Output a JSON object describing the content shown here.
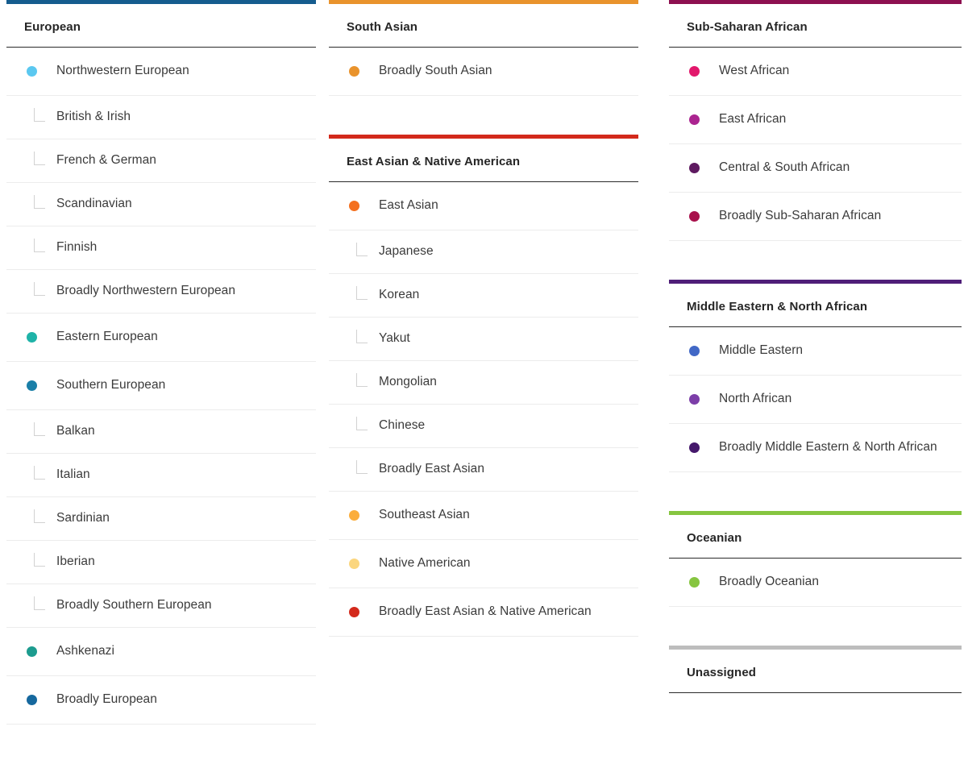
{
  "meta": {
    "title": "Ancestry Composition Legend",
    "columns": 3
  },
  "colors": {
    "european_bar": "#155C8E",
    "south_asian_bar": "#E9932C",
    "east_asian_bar": "#D3291B",
    "sub_saharan_bar": "#8D1050",
    "mena_bar": "#4F1E78",
    "oceanian_bar": "#86C540",
    "unassigned_bar": "#BDBDBD",
    "header_rule": "#2a2a2a",
    "row_divider": "#ececec",
    "elbow": "#d2d2d2",
    "title_text": "#262626",
    "label_text": "#3b3b3b"
  },
  "columns": [
    {
      "id": "column-1",
      "groups": [
        {
          "id": "group-european",
          "title": "European",
          "bar_color": "#155C8E",
          "rows": [
            {
              "label": "Northwestern European",
              "type": "dot",
              "color": "#5BC8F0"
            },
            {
              "label": "British & Irish",
              "type": "sub"
            },
            {
              "label": "French & German",
              "type": "sub"
            },
            {
              "label": "Scandinavian",
              "type": "sub"
            },
            {
              "label": "Finnish",
              "type": "sub"
            },
            {
              "label": "Broadly Northwestern European",
              "type": "sub"
            },
            {
              "label": "Eastern European",
              "type": "dot",
              "color": "#1FB3A8"
            },
            {
              "label": "Southern European",
              "type": "dot",
              "color": "#1A7FA8"
            },
            {
              "label": "Balkan",
              "type": "sub"
            },
            {
              "label": "Italian",
              "type": "sub"
            },
            {
              "label": "Sardinian",
              "type": "sub"
            },
            {
              "label": "Iberian",
              "type": "sub"
            },
            {
              "label": "Broadly Southern European",
              "type": "sub"
            },
            {
              "label": "Ashkenazi",
              "type": "dot",
              "color": "#1D9C8F"
            },
            {
              "label": "Broadly European",
              "type": "dot",
              "color": "#16689E"
            }
          ]
        }
      ]
    },
    {
      "id": "column-2",
      "groups": [
        {
          "id": "group-south-asian",
          "title": "South Asian",
          "bar_color": "#E9932C",
          "rows": [
            {
              "label": "Broadly South Asian",
              "type": "dot",
              "color": "#E9932C"
            }
          ]
        },
        {
          "id": "group-east-asian-native-american",
          "title": "East Asian & Native American",
          "bar_color": "#D3291B",
          "rows": [
            {
              "label": "East Asian",
              "type": "dot",
              "color": "#F4701F"
            },
            {
              "label": "Japanese",
              "type": "sub"
            },
            {
              "label": "Korean",
              "type": "sub"
            },
            {
              "label": "Yakut",
              "type": "sub"
            },
            {
              "label": "Mongolian",
              "type": "sub"
            },
            {
              "label": "Chinese",
              "type": "sub"
            },
            {
              "label": "Broadly East Asian",
              "type": "sub"
            },
            {
              "label": "Southeast Asian",
              "type": "dot",
              "color": "#FBAD3B"
            },
            {
              "label": "Native American",
              "type": "dot",
              "color": "#FBD67E"
            },
            {
              "label": "Broadly East Asian & Native American",
              "type": "dot",
              "color": "#D3291B"
            }
          ]
        }
      ]
    },
    {
      "id": "column-3",
      "groups": [
        {
          "id": "group-sub-saharan-african",
          "title": "Sub-Saharan African",
          "bar_color": "#8D1050",
          "rows": [
            {
              "label": "West African",
              "type": "dot",
              "color": "#E2186C"
            },
            {
              "label": "East African",
              "type": "dot",
              "color": "#AB2490"
            },
            {
              "label": "Central & South African",
              "type": "dot",
              "color": "#5E1A60"
            },
            {
              "label": "Broadly Sub-Saharan African",
              "type": "dot",
              "color": "#A8114C"
            }
          ]
        },
        {
          "id": "group-middle-eastern-north-african",
          "title": "Middle Eastern & North African",
          "bar_color": "#4F1E78",
          "rows": [
            {
              "label": "Middle Eastern",
              "type": "dot",
              "color": "#4168C6"
            },
            {
              "label": "North African",
              "type": "dot",
              "color": "#7C3EA8"
            },
            {
              "label": "Broadly Middle Eastern & North African",
              "type": "dot",
              "color": "#45186B"
            }
          ]
        },
        {
          "id": "group-oceanian",
          "title": "Oceanian",
          "bar_color": "#86C540",
          "rows": [
            {
              "label": "Broadly Oceanian",
              "type": "dot",
              "color": "#86C540"
            }
          ]
        },
        {
          "id": "group-unassigned",
          "title": "Unassigned",
          "bar_color": "#BDBDBD",
          "rows": []
        }
      ]
    }
  ]
}
